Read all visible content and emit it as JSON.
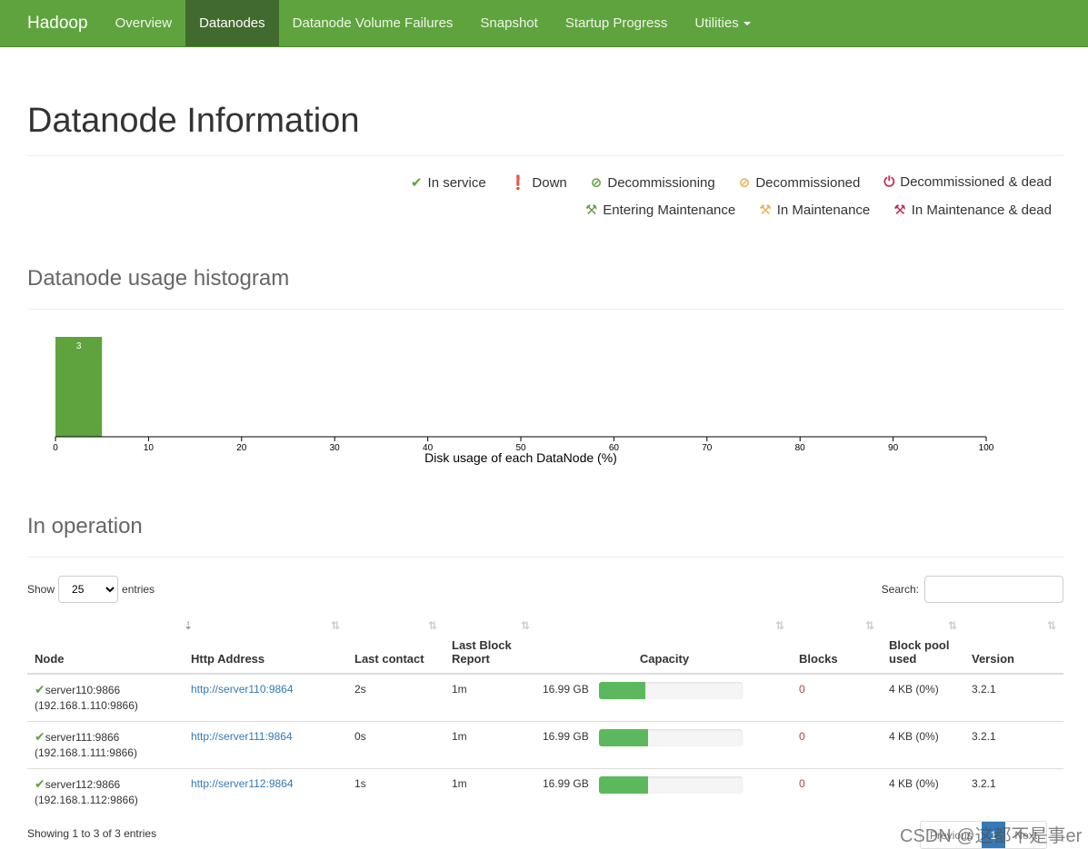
{
  "nav": {
    "brand": "Hadoop",
    "items": [
      "Overview",
      "Datanodes",
      "Datanode Volume Failures",
      "Snapshot",
      "Startup Progress",
      "Utilities"
    ],
    "active": "Datanodes"
  },
  "page_title": "Datanode Information",
  "legend": [
    {
      "label": "In service",
      "icon": "check-icon",
      "color": "#5fa33e"
    },
    {
      "label": "Down",
      "icon": "exclamation-circle-icon",
      "color": "#c7254e"
    },
    {
      "label": "Decommissioning",
      "icon": "ban-icon",
      "color": "#5fa33e"
    },
    {
      "label": "Decommissioned",
      "icon": "ban-icon",
      "color": "#f0ad4e"
    },
    {
      "label": "Decommissioned & dead",
      "icon": "power-icon",
      "color": "#c7254e"
    },
    {
      "label": "Entering Maintenance",
      "icon": "wrench-icon",
      "color": "#5fa33e"
    },
    {
      "label": "In Maintenance",
      "icon": "wrench-icon",
      "color": "#f0ad4e"
    },
    {
      "label": "In Maintenance & dead",
      "icon": "wrench-icon",
      "color": "#c7254e"
    }
  ],
  "histogram_title": "Datanode usage histogram",
  "chart_data": {
    "type": "bar",
    "xlabel": "Disk usage of each DataNode (%)",
    "xlim": [
      0,
      100
    ],
    "xticks": [
      0,
      10,
      20,
      30,
      40,
      50,
      60,
      70,
      80,
      90,
      100
    ],
    "bins": [
      {
        "from": 0,
        "to": 5,
        "count": 3
      }
    ],
    "bar_color": "#5fa33e",
    "grid": false
  },
  "operation_title": "In operation",
  "controls": {
    "show": "Show",
    "entries_value": "25",
    "entries": "entries",
    "search": "Search:",
    "search_value": ""
  },
  "columns": [
    "Node",
    "Http Address",
    "Last contact",
    "Last Block Report",
    "Capacity",
    "Blocks",
    "Block pool used",
    "Version"
  ],
  "rows": [
    {
      "node": "server110:9866",
      "ip": "(192.168.1.110:9866)",
      "http": "http://server110:9864",
      "contact": "2s",
      "report": "1m",
      "capacity": "16.99 GB",
      "used_pct": 32,
      "blocks": "0",
      "pool": "4 KB (0%)",
      "version": "3.2.1"
    },
    {
      "node": "server111:9866",
      "ip": "(192.168.1.111:9866)",
      "http": "http://server111:9864",
      "contact": "0s",
      "report": "1m",
      "capacity": "16.99 GB",
      "used_pct": 34,
      "blocks": "0",
      "pool": "4 KB (0%)",
      "version": "3.2.1"
    },
    {
      "node": "server112:9866",
      "ip": "(192.168.1.112:9866)",
      "http": "http://server112:9864",
      "contact": "1s",
      "report": "1m",
      "capacity": "16.99 GB",
      "used_pct": 34,
      "blocks": "0",
      "pool": "4 KB (0%)",
      "version": "3.2.1"
    }
  ],
  "footer": {
    "info": "Showing 1 to 3 of 3 entries",
    "prev": "Previous",
    "page": "1",
    "next": "Next"
  },
  "watermark": "CSDN @这都不是事er"
}
